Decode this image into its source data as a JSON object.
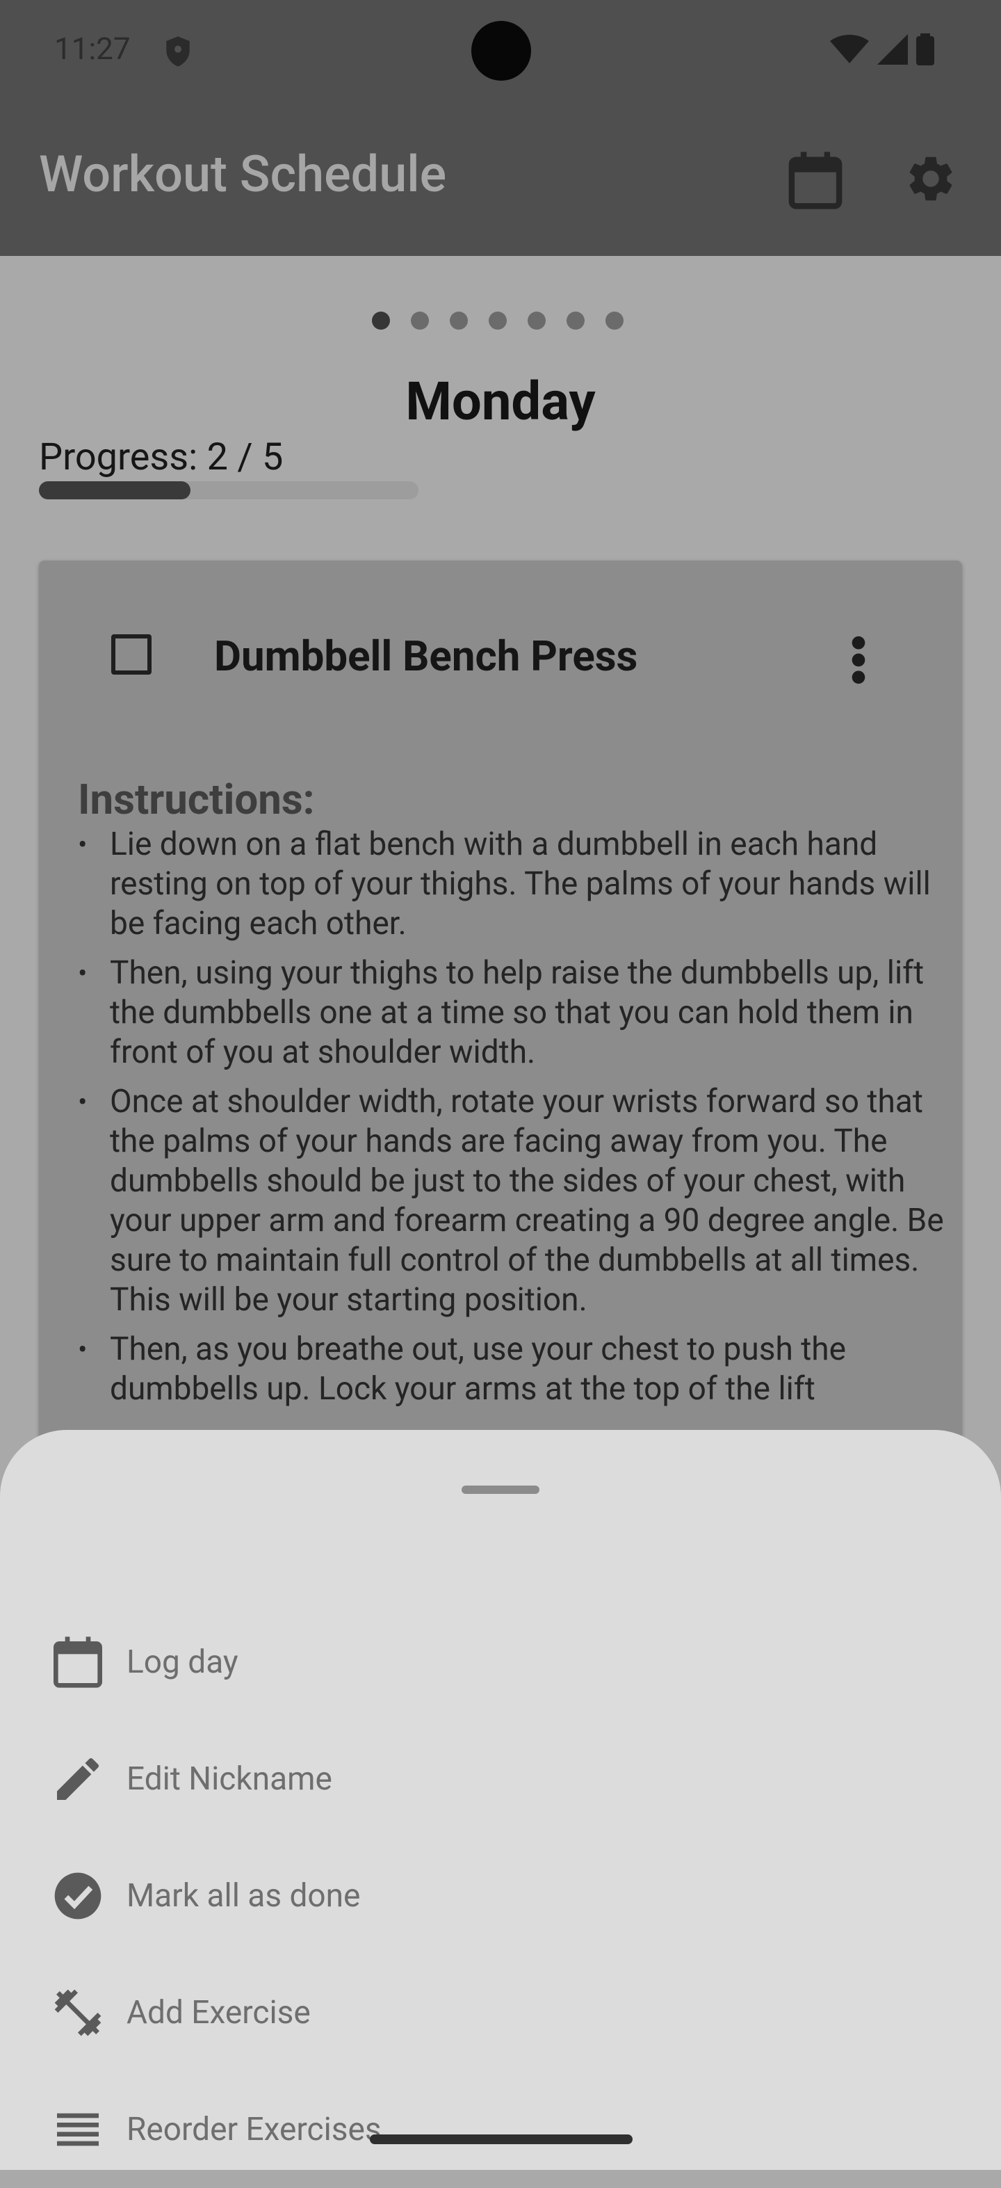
{
  "status_bar": {
    "time": "11:27"
  },
  "app_bar": {
    "title": "Workout Schedule",
    "icons": [
      "calendar-icon",
      "settings-icon"
    ]
  },
  "pager": {
    "page_count": 7,
    "active_index": 0
  },
  "day": {
    "title": "Monday"
  },
  "progress": {
    "label": "Progress: 2 / 5",
    "fraction": 0.4
  },
  "exercise": {
    "name": "Dumbbell Bench Press",
    "checked": false,
    "instructions_title": "Instructions:",
    "instructions": [
      "Lie down on a flat bench with a dumbbell in each hand resting on top of your thighs. The palms of your hands will be facing each other.",
      "Then, using your thighs to help raise the dumbbells up, lift the dumbbells one at a time so that you can hold them in front of you at shoulder width.",
      "Once at shoulder width, rotate your wrists forward so that the palms of your hands are facing away from you. The dumbbells should be just to the sides of your chest, with your upper arm and forearm creating a 90 degree angle. Be sure to maintain full control of the dumbbells at all times. This will be your starting position.",
      "Then, as you breathe out, use your chest to push the dumbbells up. Lock your arms at the top of the lift"
    ]
  },
  "bottom_sheet": {
    "items": [
      {
        "label": "Log day",
        "icon": "calendar-icon"
      },
      {
        "label": "Edit Nickname",
        "icon": "pencil-icon"
      },
      {
        "label": "Mark all as done",
        "icon": "check-circle-icon"
      },
      {
        "label": "Add Exercise",
        "icon": "dumbbell-icon"
      },
      {
        "label": "Reorder Exercises",
        "icon": "reorder-icon"
      }
    ]
  }
}
